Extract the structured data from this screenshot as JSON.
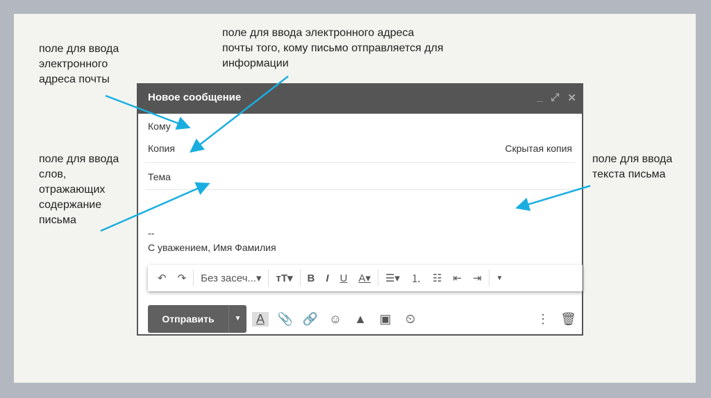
{
  "annotations": {
    "to_field": "поле для ввода\nэлектронного\nадреса почты",
    "cc_field": "поле для ввода электронного адреса\nпочты того, кому письмо отправляется для\nинформации",
    "subject_field": "поле для ввода\nслов,\nотражающих\nсодержание\nписьма",
    "body_field": "поле для ввода\nтекста письма"
  },
  "compose": {
    "title": "Новое сообщение",
    "to_label": "Кому",
    "cc_label": "Копия",
    "bcc_label": "Скрытая копия",
    "subject_label": "Тема",
    "signature_dash": "--",
    "signature": "С уважением, Имя Фамилия",
    "font_select": "Без засеч...",
    "send_label": "Отправить"
  },
  "colors": {
    "arrow": "#1aaee0",
    "header": "#555555"
  }
}
